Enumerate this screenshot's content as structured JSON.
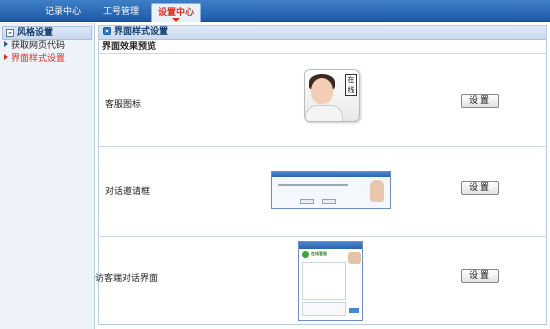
{
  "topnav": {
    "tabs": [
      {
        "label": "记录中心"
      },
      {
        "label": "工号管理"
      },
      {
        "label": "设置中心"
      }
    ],
    "active_tab": "设置中心"
  },
  "sidebar": {
    "section_title": "风格设置",
    "items": [
      {
        "label": "获取网页代码"
      },
      {
        "label": "界面样式设置"
      }
    ]
  },
  "main": {
    "title": "界面样式设置",
    "subtitle": "界面效果预览",
    "rows": [
      {
        "label": "客服图标",
        "button": "设置",
        "icon_badge": "在线"
      },
      {
        "label": "对话邀请框",
        "button": "设置"
      },
      {
        "label": "访客端对话界面",
        "button": "设置",
        "chat_name": "在线客服"
      }
    ]
  },
  "colors": {
    "nav_blue": "#1f5aa6",
    "accent_red": "#d8301c",
    "panel_border": "#b8cbe4"
  }
}
